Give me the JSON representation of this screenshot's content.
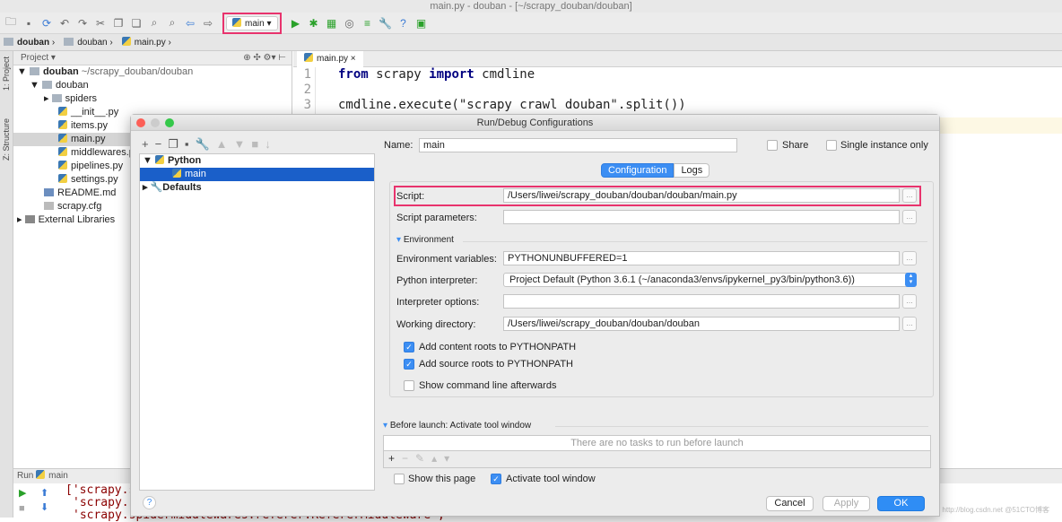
{
  "window": {
    "title": "main.py - douban - [~/scrapy_douban/douban]"
  },
  "toolbar": {
    "run_config": "main"
  },
  "breadcrumb": [
    "douban",
    "douban",
    "main.py"
  ],
  "side_tabs": {
    "project": "1: Project",
    "structure": "Z: Structure"
  },
  "project_panel": {
    "header": "Project",
    "tree": [
      {
        "label": "douban",
        "extra": "~/scrapy_douban/douban",
        "bold": true
      },
      {
        "label": "douban"
      },
      {
        "label": "spiders"
      },
      {
        "label": "__init__.py"
      },
      {
        "label": "items.py"
      },
      {
        "label": "main.py",
        "selected": true
      },
      {
        "label": "middlewares.py"
      },
      {
        "label": "pipelines.py"
      },
      {
        "label": "settings.py"
      },
      {
        "label": "README.md"
      },
      {
        "label": "scrapy.cfg"
      },
      {
        "label": "External Libraries"
      }
    ]
  },
  "editor": {
    "tab": "main.py",
    "lines": [
      "1",
      "2",
      "3"
    ],
    "code_line1_kw1": "from",
    "code_line1_mid": " scrapy ",
    "code_line1_kw2": "import",
    "code_line1_end": " cmdline",
    "code_line3": "cmdline.execute(\"scrapy crawl douban\".split())"
  },
  "run_panel": {
    "label": "Run",
    "config": "main",
    "output": [
      "['scrapy.spidermiddlewares.httperror.HttpErrorMiddleware',",
      "'scrapy.spidermiddlewares.offsite.OffsiteMiddleware',",
      "'scrapy.spidermiddlewares.referer.RefererMiddleware',"
    ]
  },
  "dialog": {
    "title": "Run/Debug Configurations",
    "tree": {
      "python": "Python",
      "main": "main",
      "defaults": "Defaults"
    },
    "name_label": "Name:",
    "name_value": "main",
    "share": "Share",
    "single_instance": "Single instance only",
    "tabs": [
      "Configuration",
      "Logs"
    ],
    "script_label": "Script:",
    "script_value": "/Users/liwei/scrapy_douban/douban/douban/main.py",
    "script_params_label": "Script parameters:",
    "script_params_value": "",
    "environment": "Environment",
    "env_vars_label": "Environment variables:",
    "env_vars_value": "PYTHONUNBUFFERED=1",
    "interpreter_label": "Python interpreter:",
    "interpreter_value": "Project Default (Python 3.6.1 (~/anaconda3/envs/ipykernel_py3/bin/python3.6))",
    "interp_opts_label": "Interpreter options:",
    "interp_opts_value": "",
    "workdir_label": "Working directory:",
    "workdir_value": "/Users/liwei/scrapy_douban/douban/douban",
    "add_content_roots": "Add content roots to PYTHONPATH",
    "add_source_roots": "Add source roots to PYTHONPATH",
    "show_cmd": "Show command line afterwards",
    "before_launch": "Before launch: Activate tool window",
    "no_tasks": "There are no tasks to run before launch",
    "show_page": "Show this page",
    "activate_tool": "Activate tool window",
    "cancel": "Cancel",
    "apply": "Apply",
    "ok": "OK",
    "help": "?"
  },
  "watermark": "http://blog.csdn.net @51CTO博客",
  "colors": {
    "highlight": "#e8336d",
    "accent": "#3c8ef3",
    "selection": "#1a5fc9"
  }
}
